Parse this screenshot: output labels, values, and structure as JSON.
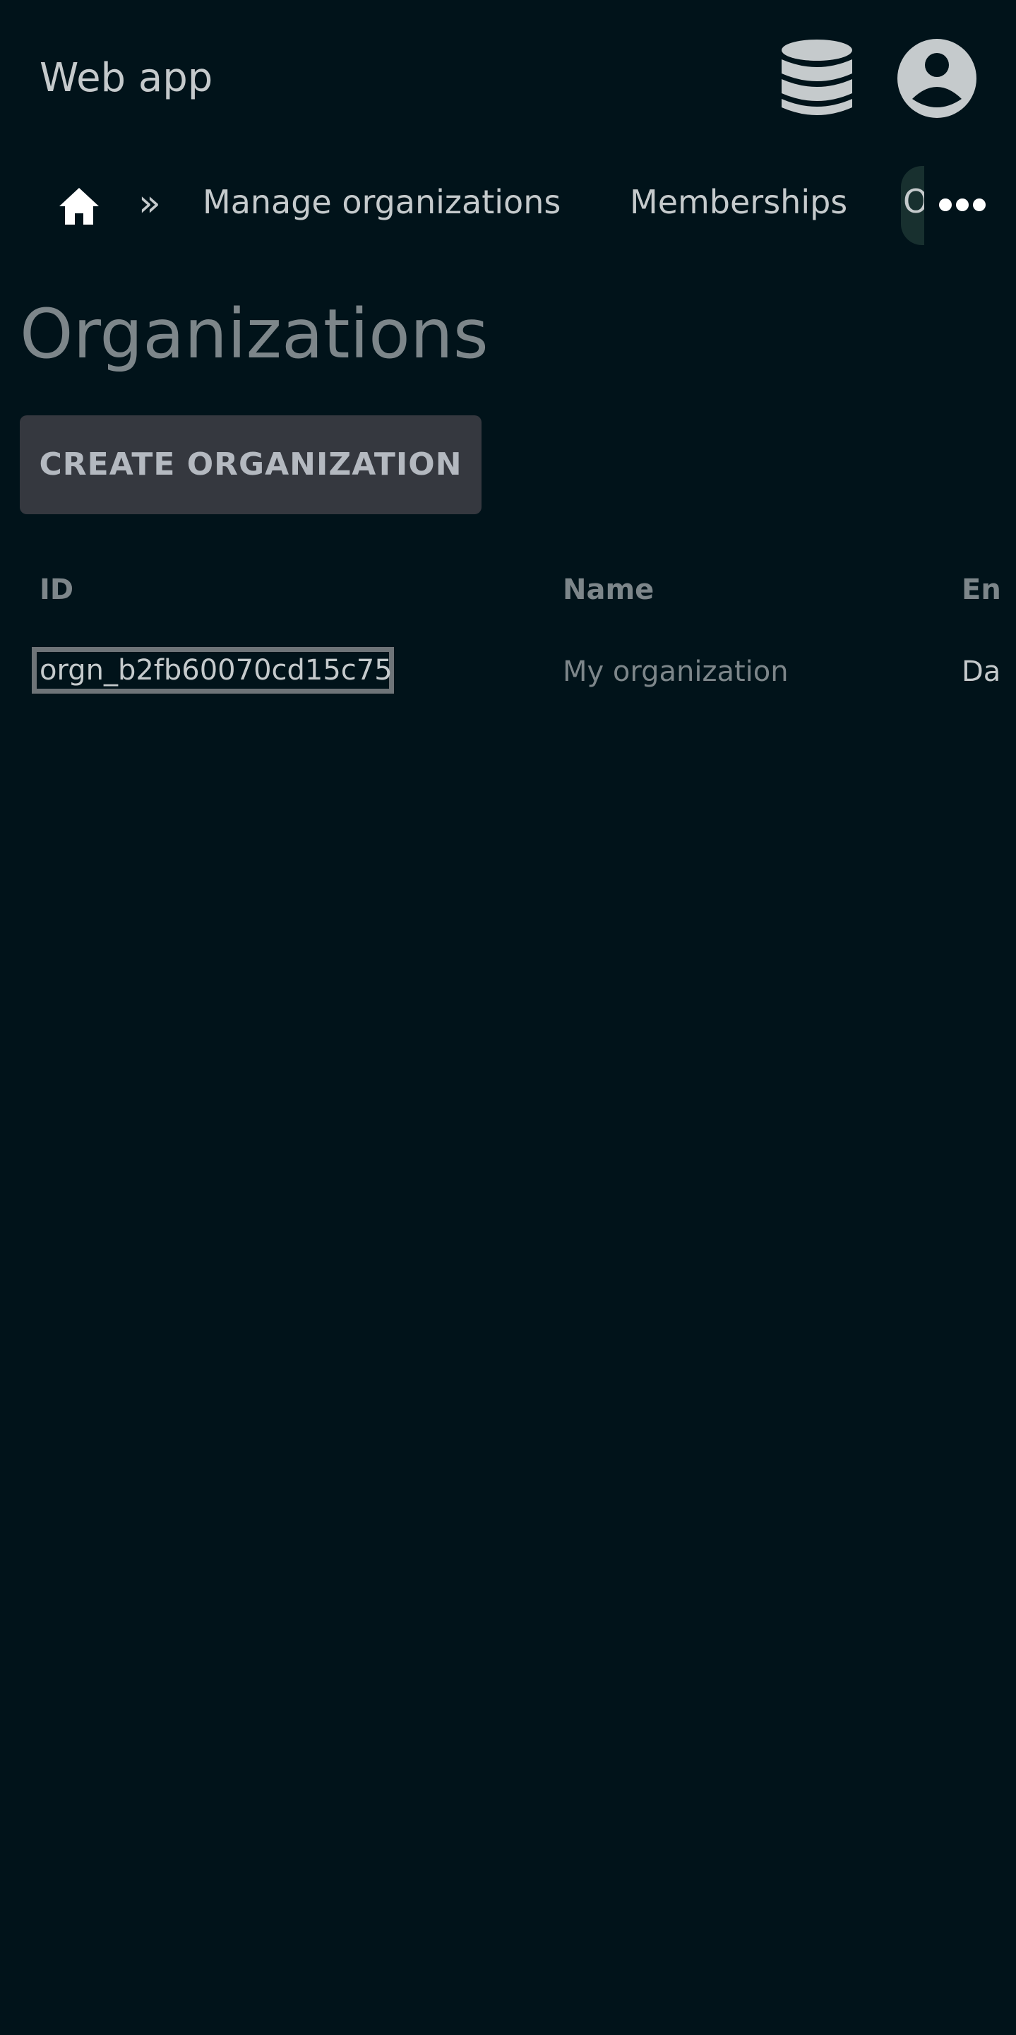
{
  "header": {
    "app_title": "Web app",
    "icons": {
      "database": "database-icon",
      "account": "user-account-icon"
    }
  },
  "nav": {
    "home_icon": "home-icon",
    "separator": "»",
    "links": [
      {
        "label": "Manage organizations"
      },
      {
        "label": "Memberships"
      }
    ],
    "clipped_label": "O",
    "more_icon": "more-horizontal-icon"
  },
  "main": {
    "title": "Organizations",
    "create_button_label": "CREATE ORGANIZATION"
  },
  "table": {
    "columns": [
      "ID",
      "Name",
      "En"
    ],
    "rows": [
      {
        "id": "orgn_b2fb60070cd15c75",
        "name": "My organization",
        "env": "Da"
      }
    ]
  },
  "colors": {
    "background": "#01131a",
    "text_primary": "#c5cacc",
    "text_muted": "#7d868a",
    "button_bg": "#35383f",
    "active_tab_bg": "#18302f"
  }
}
